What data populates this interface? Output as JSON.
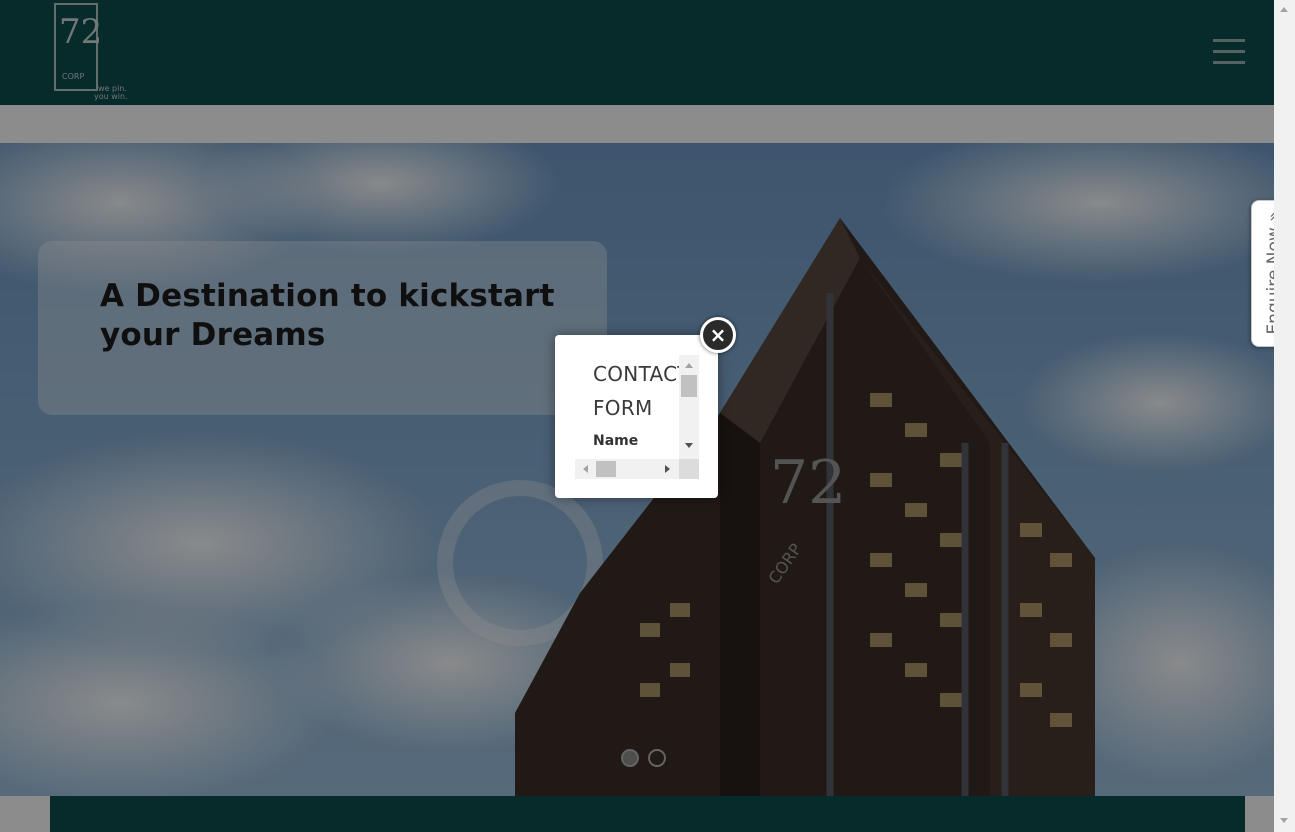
{
  "header": {
    "logo": {
      "brand_text": "72",
      "sub_text": "CORP",
      "tagline_line1": "we pin.",
      "tagline_line2": "you win."
    },
    "menu_icon": "hamburger-menu-icon"
  },
  "hero": {
    "headline": "A Destination to kickstart your Dreams",
    "building_logo_text": "72",
    "building_sub_text": "CORP",
    "slider": {
      "slides": 2,
      "active_index": 0
    }
  },
  "side_tab": {
    "label": "Enquire Now »"
  },
  "popup": {
    "title": "CONTACT FORM",
    "field_label": "Name",
    "close_icon": "close-icon"
  },
  "colors": {
    "header_bg": "#0e4d4f",
    "overlay": "rgba(0,0,0,0.45)",
    "caption_bg": "rgba(255,255,255,0.38)"
  }
}
